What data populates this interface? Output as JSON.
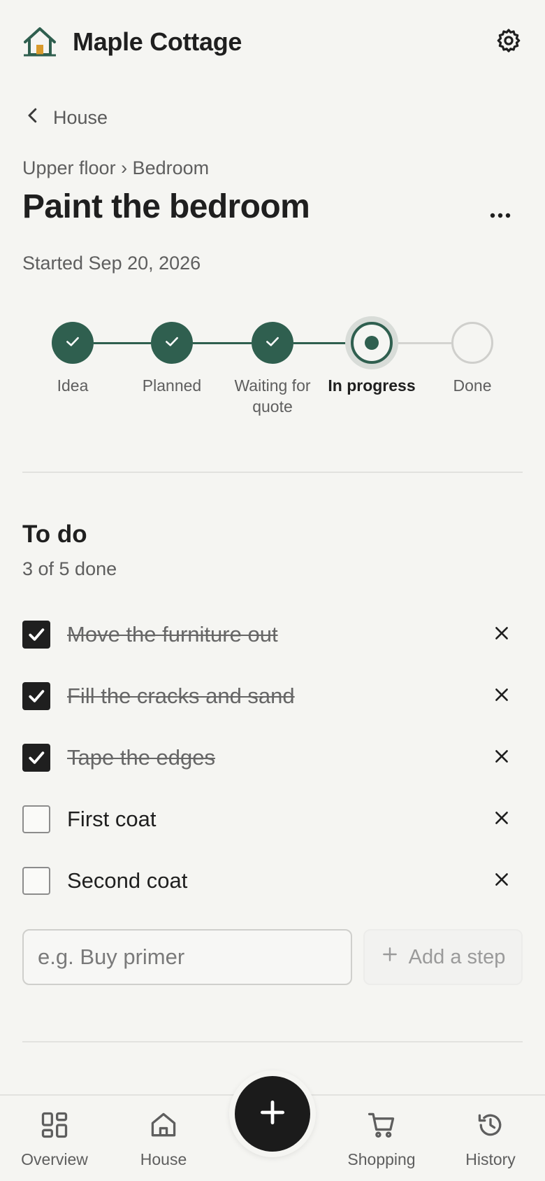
{
  "header": {
    "app_title": "Maple Cottage",
    "logo_icon": "house-logo-icon",
    "settings_icon": "gear-icon"
  },
  "back": {
    "label": "House",
    "icon": "chevron-left-icon"
  },
  "task": {
    "breadcrumb": "Upper floor › Bedroom",
    "title": "Paint the bedroom",
    "started": "Started Sep 20, 2026",
    "more_icon": "more-horizontal-icon"
  },
  "stepper": {
    "steps": [
      {
        "label": "Idea",
        "state": "done"
      },
      {
        "label": "Planned",
        "state": "done"
      },
      {
        "label": "Waiting for quote",
        "state": "done"
      },
      {
        "label": "In progress",
        "state": "current"
      },
      {
        "label": "Done",
        "state": "todo"
      }
    ]
  },
  "todo": {
    "title": "To do",
    "progress": "3 of 5 done",
    "items": [
      {
        "text": "Move the furniture out",
        "checked": true
      },
      {
        "text": "Fill the cracks and sand",
        "checked": true
      },
      {
        "text": "Tape the edges",
        "checked": true
      },
      {
        "text": "First coat",
        "checked": false
      },
      {
        "text": "Second coat",
        "checked": false
      }
    ],
    "input_placeholder": "e.g. Buy primer",
    "add_button": "Add a step"
  },
  "nav": {
    "items": [
      {
        "label": "Overview",
        "icon": "grid-icon"
      },
      {
        "label": "House",
        "icon": "home-icon"
      },
      {
        "label": "Shopping",
        "icon": "cart-icon"
      },
      {
        "label": "History",
        "icon": "history-icon"
      }
    ],
    "fab_icon": "plus-icon"
  },
  "colors": {
    "accent": "#2f5f4f",
    "background": "#f5f5f2",
    "logo_roof": "#2f5f4f",
    "logo_door": "#d99a2b"
  }
}
